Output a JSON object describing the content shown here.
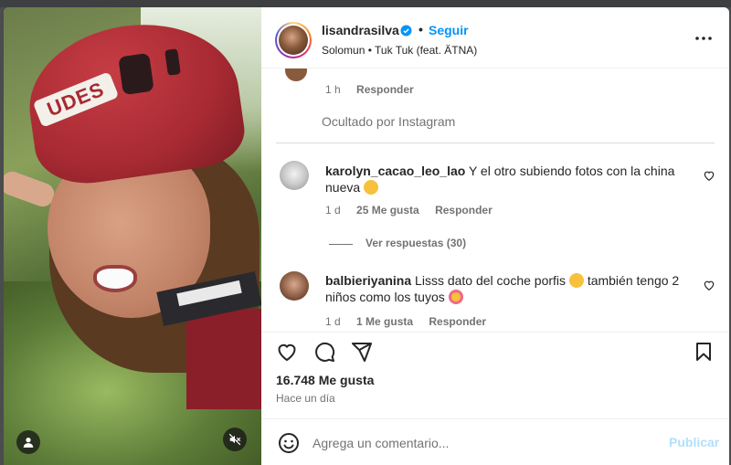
{
  "post": {
    "author": {
      "username": "lisandrasilva",
      "verified": true,
      "follow_label": "Seguir",
      "separator": "•",
      "audio": "Solomun • Tuk Tuk (feat. ÄTNA)"
    },
    "media": {
      "helmet_text": "UDES",
      "icons": [
        "user-tag-icon",
        "mute-icon"
      ]
    },
    "likes": "16.748 Me gusta",
    "posted": "Hace un día"
  },
  "comments": {
    "previous": {
      "time": "1 h",
      "reply_label": "Responder"
    },
    "hidden_note": "Ocultado por Instagram",
    "items": [
      {
        "username": "karolyn_cacao_leo_lao",
        "text": "Y el otro subiendo fotos con la china nueva",
        "emoji": "flushed-face-emoji",
        "time": "1 d",
        "likes": "25 Me gusta",
        "reply_label": "Responder",
        "view_replies": "Ver respuestas (30)"
      },
      {
        "username": "balbieriyanina",
        "text_part1": "Lisss dato del coche porfis",
        "emoji1": "face-screaming-emoji",
        "text_part2": "también tengo 2 niños como los tuyos",
        "emoji2": "smiling-hearts-emoji",
        "time": "1 d",
        "likes": "1 Me gusta",
        "reply_label": "Responder"
      }
    ]
  },
  "actions": {
    "icons": [
      "heart-icon",
      "comment-icon",
      "share-icon",
      "bookmark-icon"
    ]
  },
  "composer": {
    "placeholder": "Agrega un comentario...",
    "post_label": "Publicar"
  },
  "colors": {
    "accent": "#0095f6",
    "text": "#262626",
    "muted": "#737373",
    "post_disabled": "#b2dffc"
  }
}
